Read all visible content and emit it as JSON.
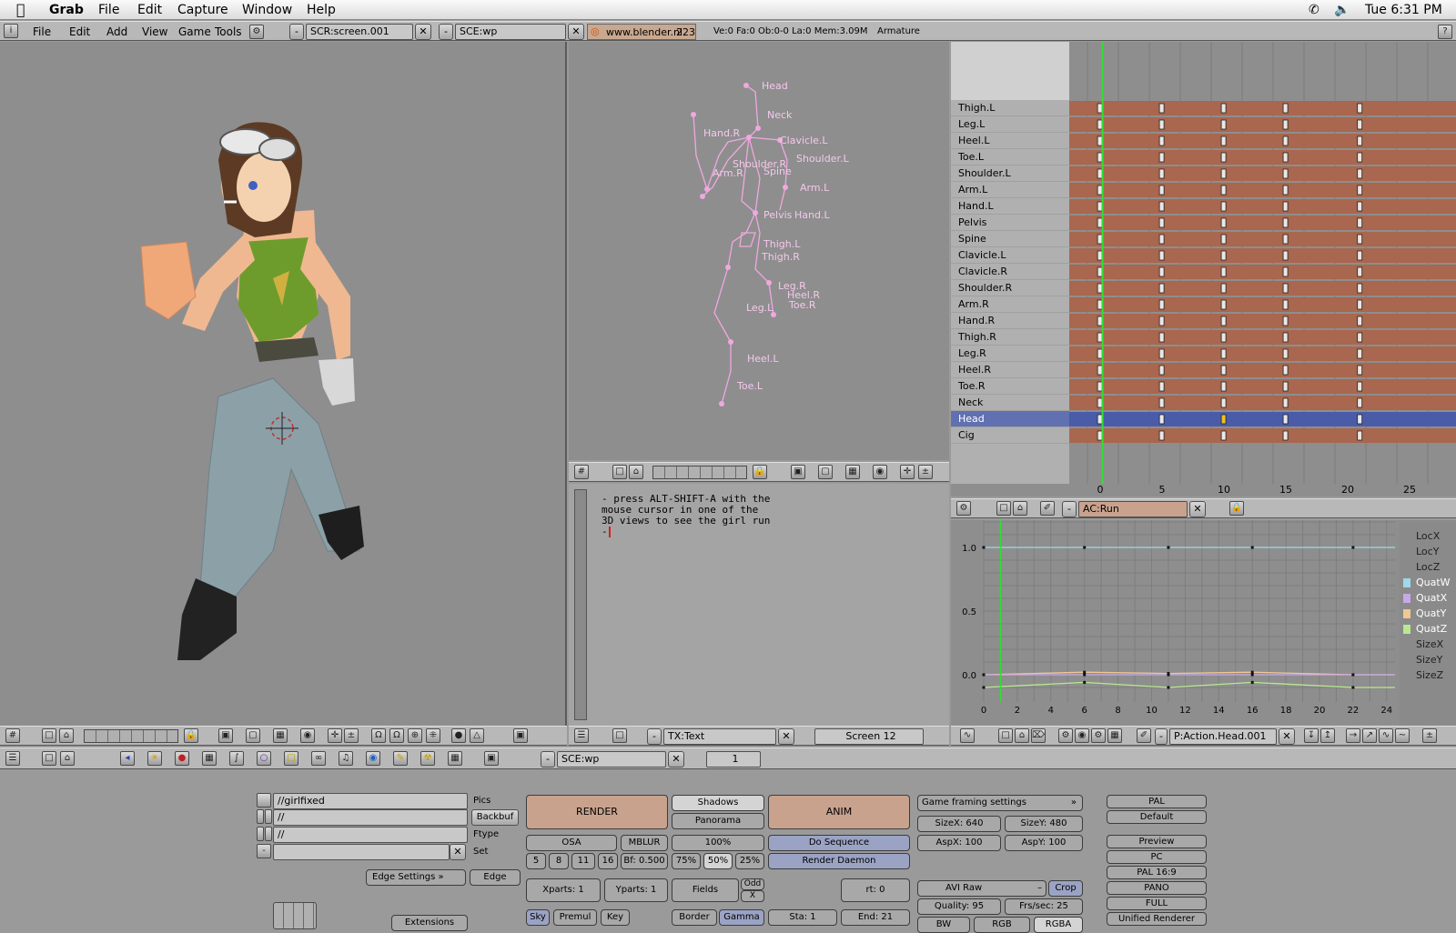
{
  "mac_menubar": {
    "app": "Grab",
    "menus": [
      "File",
      "Edit",
      "Capture",
      "Window",
      "Help"
    ],
    "clock": "Tue 6:31 PM"
  },
  "info_header": {
    "menus": [
      "File",
      "Edit",
      "Add",
      "View",
      "Game",
      "Tools"
    ],
    "screen": "SCR:screen.001",
    "scene": "SCE:wp",
    "site": "www.blender.nl",
    "version": "223",
    "stats": "Ve:0 Fa:0  Ob:0-0 La:0  Mem:3.09M",
    "armature": "Armature"
  },
  "armature_view": {
    "bones": [
      {
        "label": "Head"
      },
      {
        "label": "Neck"
      },
      {
        "label": "Hand.R"
      },
      {
        "label": "Clavicle.L"
      },
      {
        "label": "Shoulder.L"
      },
      {
        "label": "Shoulder.R"
      },
      {
        "label": "Arm.R"
      },
      {
        "label": "Spine"
      },
      {
        "label": "Arm.L"
      },
      {
        "label": "Pelvis"
      },
      {
        "label": "Hand.L"
      },
      {
        "label": "Thigh.L"
      },
      {
        "label": "Thigh.R"
      },
      {
        "label": "Leg.R"
      },
      {
        "label": "Heel.R"
      },
      {
        "label": "Toe.R"
      },
      {
        "label": "Leg.L"
      },
      {
        "label": "Heel.L"
      },
      {
        "label": "Toe.L"
      }
    ]
  },
  "text_editor": {
    "lines": [
      "- press ALT-SHIFT-A with the",
      "mouse cursor in one of the",
      "3D views to see the girl run",
      "-"
    ],
    "name": "TX:Text",
    "screen": "Screen 12"
  },
  "action_editor": {
    "channels": [
      "Thigh.L",
      "Leg.L",
      "Heel.L",
      "Toe.L",
      "Shoulder.L",
      "Arm.L",
      "Hand.L",
      "Pelvis",
      "Spine",
      "Clavicle.L",
      "Clavicle.R",
      "Shoulder.R",
      "Arm.R",
      "Hand.R",
      "Thigh.R",
      "Leg.R",
      "Heel.R",
      "Toe.R",
      "Neck",
      "Head",
      "Cig"
    ],
    "selected": "Head",
    "ticks": [
      "0",
      "5",
      "10",
      "15",
      "20",
      "25"
    ],
    "action_name": "AC:Run",
    "keyframes": [
      1,
      6,
      11,
      16,
      22
    ],
    "current_frame": 1
  },
  "ipo_editor": {
    "yticks": [
      "1.0",
      "0.5",
      "0.0"
    ],
    "xticks": [
      "0",
      "2",
      "4",
      "6",
      "8",
      "10",
      "12",
      "14",
      "16",
      "18",
      "20",
      "22",
      "24"
    ],
    "channels": [
      {
        "name": "LocX",
        "color": ""
      },
      {
        "name": "LocY",
        "color": ""
      },
      {
        "name": "LocZ",
        "color": ""
      },
      {
        "name": "QuatW",
        "color": "#9fd8e8"
      },
      {
        "name": "QuatX",
        "color": "#c8a8e8"
      },
      {
        "name": "QuatY",
        "color": "#f0c890"
      },
      {
        "name": "QuatZ",
        "color": "#b8e890"
      },
      {
        "name": "SizeX",
        "color": ""
      },
      {
        "name": "SizeY",
        "color": ""
      },
      {
        "name": "SizeZ",
        "color": ""
      }
    ],
    "ipo_name": "P:Action.Head.001"
  },
  "buttons_header": {
    "scene": "SCE:wp",
    "frame": "1"
  },
  "render_panel": {
    "pics": "//girlfixed",
    "backbuf": "//",
    "ftype": "//",
    "labels": {
      "pics": "Pics",
      "backbuf": "Backbuf",
      "ftype": "Ftype",
      "set": "Set"
    },
    "edge_settings": "Edge Settings",
    "edge": "Edge",
    "extensions": "Extensions",
    "render": "RENDER",
    "shadows": "Shadows",
    "panorama": "Panorama",
    "anim": "ANIM",
    "osa": "OSA",
    "mblur": "MBLUR",
    "pct100": "100%",
    "osa_vals": [
      "5",
      "8",
      "11",
      "16"
    ],
    "bf": "Bf: 0.500",
    "pcts": [
      "75%",
      "50%",
      "25%"
    ],
    "do_sequence": "Do Sequence",
    "render_daemon": "Render Daemon",
    "xparts": "Xparts: 1",
    "yparts": "Yparts: 1",
    "fields": "Fields",
    "odd": "Odd",
    "x": "X",
    "rt": "rt: 0",
    "sky": "Sky",
    "premul": "Premul",
    "key": "Key",
    "border": "Border",
    "gamma": "Gamma",
    "sta": "Sta: 1",
    "end": "End: 21",
    "game_framing": "Game framing settings",
    "sizex": "SizeX: 640",
    "sizey": "SizeY: 480",
    "aspx": "AspX: 100",
    "aspy": "AspY: 100",
    "format": "AVI Raw",
    "crop": "Crop",
    "quality": "Quality: 95",
    "fps": "Frs/sec: 25",
    "bw": "BW",
    "rgb": "RGB",
    "rgba": "RGBA",
    "presets": [
      "PAL",
      "Default",
      "Preview",
      "PC",
      "PAL 16:9",
      "PANO",
      "FULL",
      "Unified Renderer"
    ]
  }
}
